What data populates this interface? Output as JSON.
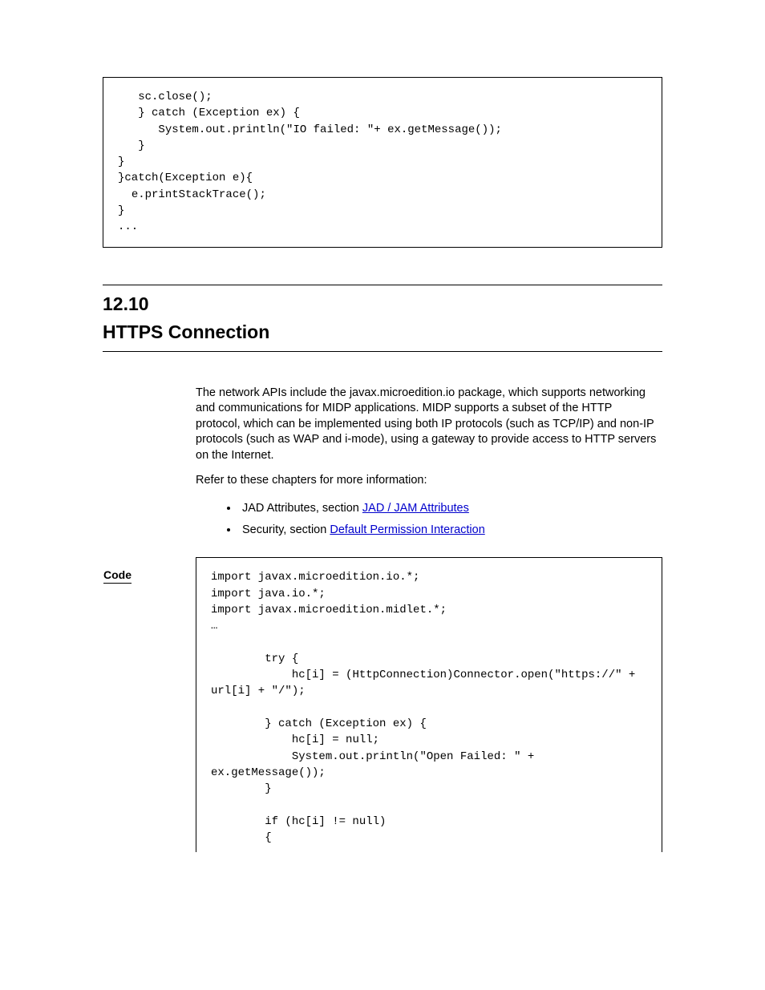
{
  "codeTop": "   sc.close();\n   } catch (Exception ex) {\n      System.out.println(\"IO failed: \"+ ex.getMessage());\n   }\n}\n}catch(Exception e){\n  e.printStackTrace();\n}\n...",
  "section": {
    "number": "12.10",
    "title": "HTTPS Connection"
  },
  "para1": "The network APIs include the javax.microedition.io package, which supports networking and communications for MIDP applications. MIDP supports a subset of the HTTP protocol, which can be implemented using both IP protocols (such as TCP/IP) and non-IP protocols (such as WAP and i-mode), using a gateway to provide access to HTTP servers on the Internet.",
  "para2": "Refer to these chapters for more information:",
  "bullet1_a": "JAD Attributes, section ",
  "bullet1_link": "JAD / JAM Attributes",
  "bullet2_a": "Security, section ",
  "bullet2_link": "Default Permission Interaction",
  "codeLabel": "Code",
  "codeBottom": "import javax.microedition.io.*;\nimport java.io.*;\nimport javax.microedition.midlet.*;\n…\n\n        try {\n            hc[i] = (HttpConnection)Connector.open(\"https://\" + url[i] + \"/\");\n\n        } catch (Exception ex) {\n            hc[i] = null;\n            System.out.println(\"Open Failed: \" + ex.getMessage());\n        }\n\n        if (hc[i] != null)\n        {"
}
